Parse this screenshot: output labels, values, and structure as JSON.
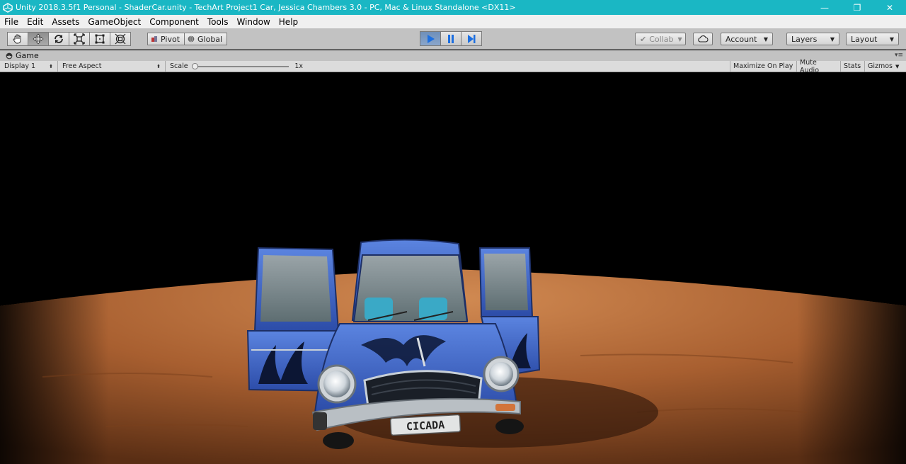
{
  "window": {
    "title": "Unity 2018.3.5f1 Personal - ShaderCar.unity - TechArt Project1 Car, Jessica Chambers 3.0 - PC, Mac & Linux Standalone <DX11>",
    "minimize": "—",
    "restore": "❐",
    "close": "✕"
  },
  "menu": [
    "File",
    "Edit",
    "Assets",
    "GameObject",
    "Component",
    "Tools",
    "Window",
    "Help"
  ],
  "toolbar": {
    "pivot": "Pivot",
    "global": "Global",
    "collab": "Collab",
    "account": "Account",
    "layers": "Layers",
    "layout": "Layout"
  },
  "game_tab": {
    "title": "Game",
    "display": "Display 1",
    "aspect": "Free Aspect",
    "scale_label": "Scale",
    "scale_value": "1x",
    "maximize_on_play": "Maximize On Play",
    "mute_audio": "Mute Audio",
    "stats": "Stats",
    "gizmos": "Gizmos"
  },
  "scene": {
    "license_plate": "CICADA"
  },
  "colors": {
    "titlebar": "#1ab7c4",
    "car_body": "#3d63c9",
    "ground": "#b76f3c"
  }
}
